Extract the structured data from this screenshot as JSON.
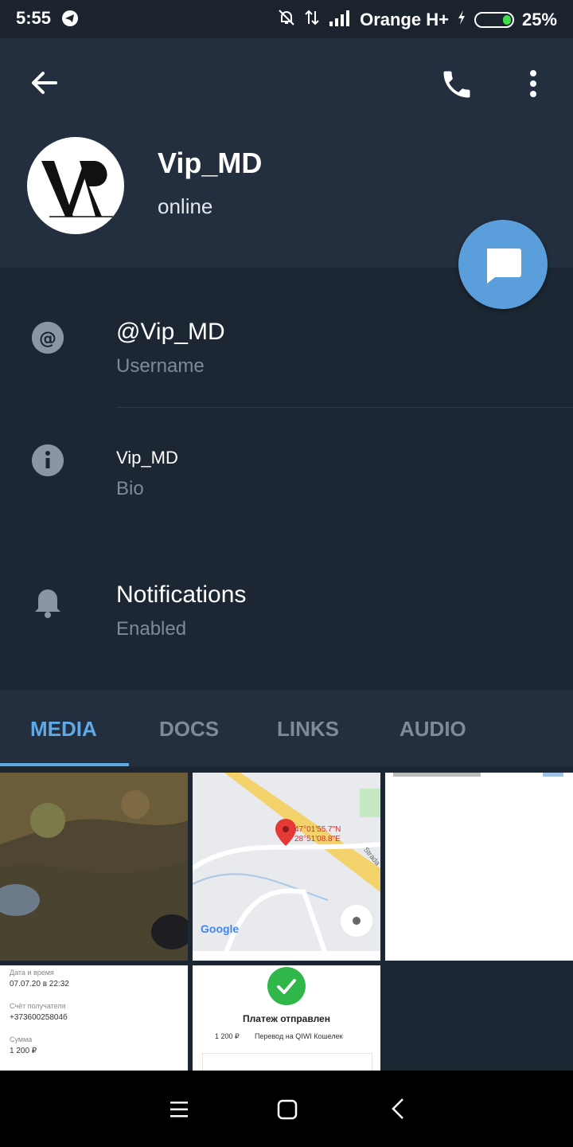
{
  "status_bar": {
    "time": "5:55",
    "carrier": "Orange H+",
    "battery": "25%"
  },
  "header": {
    "name": "Vip_MD",
    "status": "online"
  },
  "info": {
    "username_value": "@Vip_MD",
    "username_label": "Username",
    "bio_value": "Vip_MD",
    "bio_label": "Bio"
  },
  "notifications": {
    "title": "Notifications",
    "value": "Enabled"
  },
  "tabs": [
    {
      "label": "MEDIA",
      "active": true
    },
    {
      "label": "DOCS",
      "active": false
    },
    {
      "label": "LINKS",
      "active": false
    },
    {
      "label": "AUDIO",
      "active": false
    }
  ],
  "media": {
    "map": {
      "coord1": "47°01'55.7\"N",
      "coord2": "28°51'08.8\"E",
      "street": "Strada",
      "google": "Google"
    },
    "receipt": {
      "label1": "Дата и время",
      "value1": "07.07.20 в 22:32",
      "label2": "Счёт получателя",
      "value2": "+37360025804б",
      "label3": "Сумма",
      "value3": "1 200 ₽"
    },
    "payment": {
      "title": "Платеж отправлен",
      "amount": "1 200 ₽",
      "desc": "Перевод на QIWI Кошелек"
    }
  },
  "colors": {
    "accent": "#5ea9e6",
    "fab": "#5a9fdb",
    "header_bg": "#232f3e",
    "body_bg": "#1d2733"
  }
}
